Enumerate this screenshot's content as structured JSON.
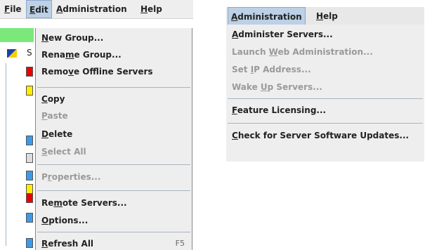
{
  "left": {
    "menubar": [
      {
        "label": "File",
        "mnemonic": "F",
        "rest": "ile"
      },
      {
        "label": "Edit",
        "mnemonic": "E",
        "rest": "dit"
      },
      {
        "label": "Administration",
        "mnemonic": "A",
        "rest": "dministration"
      },
      {
        "label": "Help",
        "mnemonic": "H",
        "rest": "elp"
      }
    ],
    "tree_text_fragment": "S",
    "edit_menu": {
      "items": [
        {
          "pre": "",
          "u": "N",
          "post": "ew Group...",
          "enabled": true
        },
        {
          "pre": "Rena",
          "u": "m",
          "post": "e Group...",
          "enabled": true
        },
        {
          "pre": "Remo",
          "u": "v",
          "post": "e Offline Servers",
          "enabled": true
        },
        {
          "pre": "",
          "u": "C",
          "post": "opy",
          "enabled": true
        },
        {
          "pre": "",
          "u": "P",
          "post": "aste",
          "enabled": false
        },
        {
          "pre": "",
          "u": "D",
          "post": "elete",
          "enabled": true
        },
        {
          "pre": "",
          "u": "S",
          "post": "elect All",
          "enabled": false
        },
        {
          "pre": "P",
          "u": "r",
          "post": "operties...",
          "enabled": false
        },
        {
          "pre": "Re",
          "u": "m",
          "post": "ote Servers...",
          "enabled": true
        },
        {
          "pre": "",
          "u": "O",
          "post": "ptions...",
          "enabled": true
        },
        {
          "pre": "",
          "u": "R",
          "post": "efresh All",
          "enabled": true,
          "accelerator": "F5"
        }
      ]
    }
  },
  "right": {
    "menubar": [
      {
        "label": "Administration",
        "mnemonic": "A",
        "rest": "dministration"
      },
      {
        "label": "Help",
        "mnemonic": "H",
        "rest": "elp"
      }
    ],
    "admin_menu": {
      "items": [
        {
          "pre": "",
          "u": "A",
          "post": "dminister Servers...",
          "enabled": true
        },
        {
          "pre": "Launch ",
          "u": "W",
          "post": "eb Administration...",
          "enabled": false
        },
        {
          "pre": "Set ",
          "u": "I",
          "post": "P Address...",
          "enabled": false
        },
        {
          "pre": "Wake ",
          "u": "U",
          "post": "p Servers...",
          "enabled": false
        },
        {
          "pre": "",
          "u": "F",
          "post": "eature Licensing...",
          "enabled": true
        },
        {
          "pre": "",
          "u": "C",
          "post": "heck for Server Software Updates...",
          "enabled": true
        }
      ]
    }
  },
  "colors": {
    "menu_bg": "#eeeeee",
    "disabled_text": "#9a9a9a",
    "active_menu_title": "#bcd0e6",
    "green_bar": "#7ce87c"
  }
}
